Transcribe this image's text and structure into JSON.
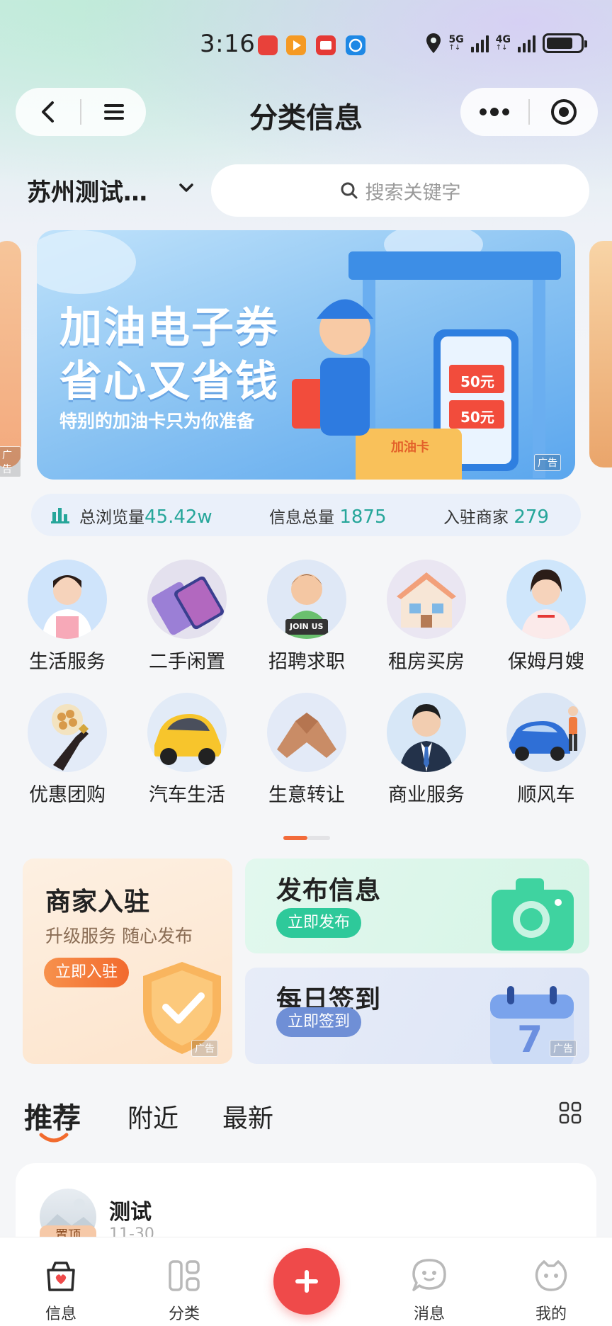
{
  "status_bar": {
    "time": "3:16",
    "net1": "5G",
    "net2": "4G"
  },
  "nav": {
    "title": "分类信息"
  },
  "location": {
    "city": "苏州测试…"
  },
  "search": {
    "placeholder": "搜索关键字"
  },
  "banner": {
    "line1": "加油电子券",
    "line2": "省心又省钱",
    "subtitle": "特别的加油卡只为你准备",
    "coupon1": "50元",
    "coupon2": "50元",
    "card_label": "加油卡",
    "ad_label": "广告",
    "side_ad_label": "广告"
  },
  "stats": {
    "views_label": "总浏览量",
    "views_value": "45.42w",
    "posts_label": "信息总量",
    "posts_value": "1875",
    "merchants_label": "入驻商家",
    "merchants_value": "279"
  },
  "categories": [
    {
      "label": "生活服务",
      "icon": "housekeeper-woman-icon"
    },
    {
      "label": "二手闲置",
      "icon": "smartphone-icon"
    },
    {
      "label": "招聘求职",
      "icon": "join-us-boy-icon",
      "sign": "JOIN US"
    },
    {
      "label": "租房买房",
      "icon": "house-icon"
    },
    {
      "label": "保姆月嫂",
      "icon": "nanny-woman-icon"
    },
    {
      "label": "优惠团购",
      "icon": "nuts-wine-icon"
    },
    {
      "label": "汽车生活",
      "icon": "yellow-car-icon"
    },
    {
      "label": "生意转让",
      "icon": "handshake-icon"
    },
    {
      "label": "商业服务",
      "icon": "businessman-icon"
    },
    {
      "label": "顺风车",
      "icon": "blue-car-icon"
    }
  ],
  "promo": {
    "merchant": {
      "title": "商家入驻",
      "subtitle": "升级服务 随心发布",
      "button": "立即入驻",
      "ad_label": "广告"
    },
    "publish": {
      "title": "发布信息",
      "button": "立即发布"
    },
    "checkin": {
      "title": "每日签到",
      "button": "立即签到",
      "calendar_day": "7",
      "ad_label": "广告"
    }
  },
  "feed_tabs": [
    "推荐",
    "附近",
    "最新"
  ],
  "feed": [
    {
      "title": "测试",
      "date": "11-30",
      "badge": "置顶"
    }
  ],
  "tabbar": [
    {
      "label": "信息",
      "icon": "info-bag-icon"
    },
    {
      "label": "分类",
      "icon": "category-grid-icon"
    },
    {
      "label": "",
      "icon": "plus-icon"
    },
    {
      "label": "消息",
      "icon": "message-icon"
    },
    {
      "label": "我的",
      "icon": "profile-icon"
    }
  ],
  "colors": {
    "accent_red": "#ef4a4a",
    "accent_orange": "#f5803e",
    "stat_teal": "#26a69a",
    "publish_green": "#2ec99a",
    "checkin_blue": "#6f8fd6"
  }
}
